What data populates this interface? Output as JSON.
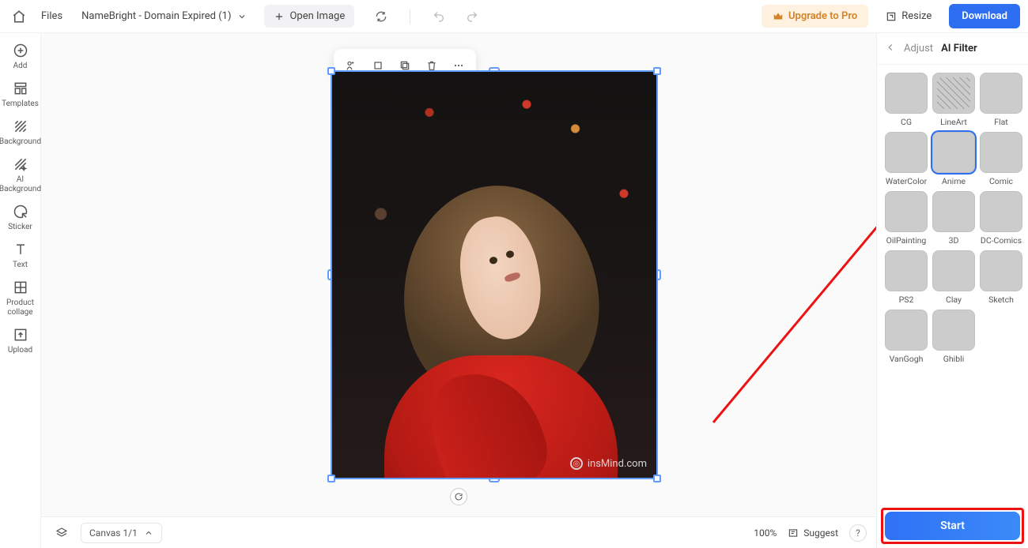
{
  "topbar": {
    "files": "Files",
    "doc_name": "NameBright - Domain Expired (1)",
    "open_image": "Open Image",
    "upgrade": "Upgrade to Pro",
    "resize": "Resize",
    "download": "Download"
  },
  "sidebar": {
    "items": [
      {
        "id": "add",
        "label": "Add"
      },
      {
        "id": "templates",
        "label": "Templates"
      },
      {
        "id": "background",
        "label": "Background"
      },
      {
        "id": "ai-background",
        "label": "AI Background"
      },
      {
        "id": "sticker",
        "label": "Sticker"
      },
      {
        "id": "text",
        "label": "Text"
      },
      {
        "id": "product-collage",
        "label": "Product collage"
      },
      {
        "id": "upload",
        "label": "Upload"
      }
    ]
  },
  "canvas": {
    "watermark": "insMind.com"
  },
  "bottombar": {
    "canvas_label": "Canvas 1/1",
    "zoom": "100%",
    "suggest": "Suggest",
    "help": "?"
  },
  "rightpanel": {
    "adjust": "Adjust",
    "ai_filter": "AI Filter",
    "filters": [
      {
        "id": "cg",
        "label": "CG"
      },
      {
        "id": "lineart",
        "label": "LineArt"
      },
      {
        "id": "flat",
        "label": "Flat"
      },
      {
        "id": "watercolor",
        "label": "WaterColor"
      },
      {
        "id": "anime",
        "label": "Anime",
        "selected": true
      },
      {
        "id": "comic",
        "label": "Comic"
      },
      {
        "id": "oilpainting",
        "label": "OilPainting"
      },
      {
        "id": "3d",
        "label": "3D"
      },
      {
        "id": "dc-comics",
        "label": "DC-Comics"
      },
      {
        "id": "ps2",
        "label": "PS2"
      },
      {
        "id": "clay",
        "label": "Clay"
      },
      {
        "id": "sketch",
        "label": "Sketch"
      },
      {
        "id": "vangogh",
        "label": "VanGogh"
      },
      {
        "id": "ghibli",
        "label": "Ghibli"
      }
    ],
    "start": "Start"
  }
}
